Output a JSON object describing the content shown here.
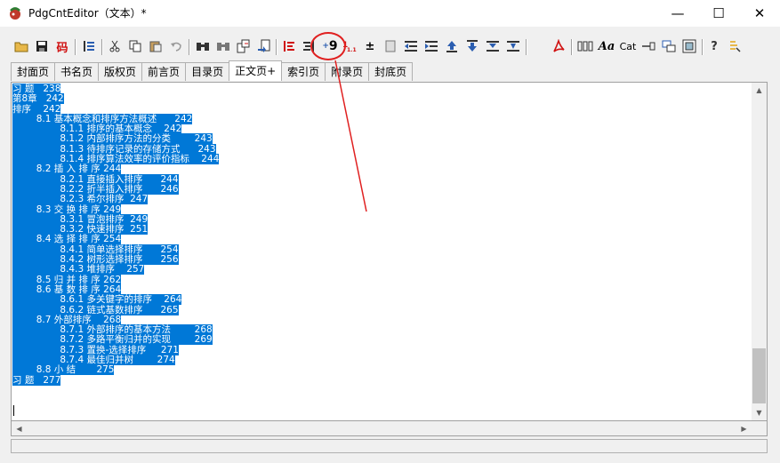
{
  "window": {
    "title": "PdgCntEditor（文本）*",
    "minimize_glyph": "—",
    "maximize_glyph": "☐",
    "close_glyph": "✕"
  },
  "toolbar": {
    "items": [
      {
        "icon": "open-folder-icon"
      },
      {
        "icon": "save-icon"
      },
      {
        "icon": "encoding-icon",
        "label": "码"
      },
      {
        "icon": "outline-icon"
      },
      {
        "icon": "cut-icon"
      },
      {
        "icon": "copy-icon"
      },
      {
        "icon": "paste-icon"
      },
      {
        "icon": "undo-icon"
      },
      {
        "icon": "find-icon"
      },
      {
        "icon": "find-next-icon"
      },
      {
        "icon": "replace-icon"
      },
      {
        "icon": "goto-icon"
      },
      {
        "icon": "align-left-icon"
      },
      {
        "icon": "align-right-icon"
      },
      {
        "icon": "page-number-offset-icon",
        "label": "9"
      },
      {
        "icon": "numbering-icon"
      },
      {
        "icon": "plus-minus-icon",
        "label": "±"
      },
      {
        "icon": "page-icon"
      },
      {
        "icon": "indent-decrease-icon"
      },
      {
        "icon": "indent-increase-icon"
      },
      {
        "icon": "move-up-icon"
      },
      {
        "icon": "move-down-icon"
      },
      {
        "icon": "sort-icon"
      },
      {
        "icon": "range-icon"
      },
      {
        "icon": "pdf-icon"
      },
      {
        "icon": "columns-icon"
      },
      {
        "icon": "font-icon",
        "label": "Aa"
      },
      {
        "icon": "catalog-icon",
        "label": "Cat"
      },
      {
        "icon": "link-icon"
      },
      {
        "icon": "window-icon"
      },
      {
        "icon": "export-icon"
      },
      {
        "icon": "help-icon",
        "label": "?"
      },
      {
        "icon": "info-icon"
      }
    ]
  },
  "tabs": [
    {
      "label": "封面页",
      "active": false
    },
    {
      "label": "书名页",
      "active": false
    },
    {
      "label": "版权页",
      "active": false
    },
    {
      "label": "前言页",
      "active": false
    },
    {
      "label": "目录页",
      "active": false
    },
    {
      "label": "正文页+",
      "active": true
    },
    {
      "label": "索引页",
      "active": false
    },
    {
      "label": "附录页",
      "active": false
    },
    {
      "label": "封底页",
      "active": false
    }
  ],
  "editor": {
    "lines": [
      "习 题   238",
      "第8章   242",
      "排序    242",
      "        8.1 基本概念和排序方法概述      242",
      "                8.1.1 排序的基本概念    242",
      "                8.1.2 内部排序方法的分类        243",
      "                8.1.3 待排序记录的存储方式      243",
      "                8.1.4 排序算法效率的评价指标    244",
      "        8.2 插 入 排 序 244",
      "                8.2.1 直接插入排序      244",
      "                8.2.2 折半插入排序      246",
      "                8.2.3 希尔排序  247",
      "        8.3 交 换 排 序 249",
      "                8.3.1 冒泡排序  249",
      "                8.3.2 快速排序  251",
      "        8.4 选 择 排 序 254",
      "                8.4.1 简单选择排序      254",
      "                8.4.2 树形选择排序      256",
      "                8.4.3 堆排序    257",
      "        8.5 归 并 排 序 262",
      "        8.6 基 数 排 序 264",
      "                8.6.1 多关键字的排序    264",
      "                8.6.2 链式基数排序      265",
      "        8.7 外部排序    268",
      "                8.7.1 外部排序的基本方法        268",
      "                8.7.2 多路平衡归并的实现        269",
      "                8.7.3 置换-选择排序     271",
      "                8.7.4 最佳归并树        274",
      "        8.8 小 结       275",
      "习 题   277"
    ]
  },
  "colors": {
    "selection": "#0078d7",
    "annotation": "#e02020"
  }
}
